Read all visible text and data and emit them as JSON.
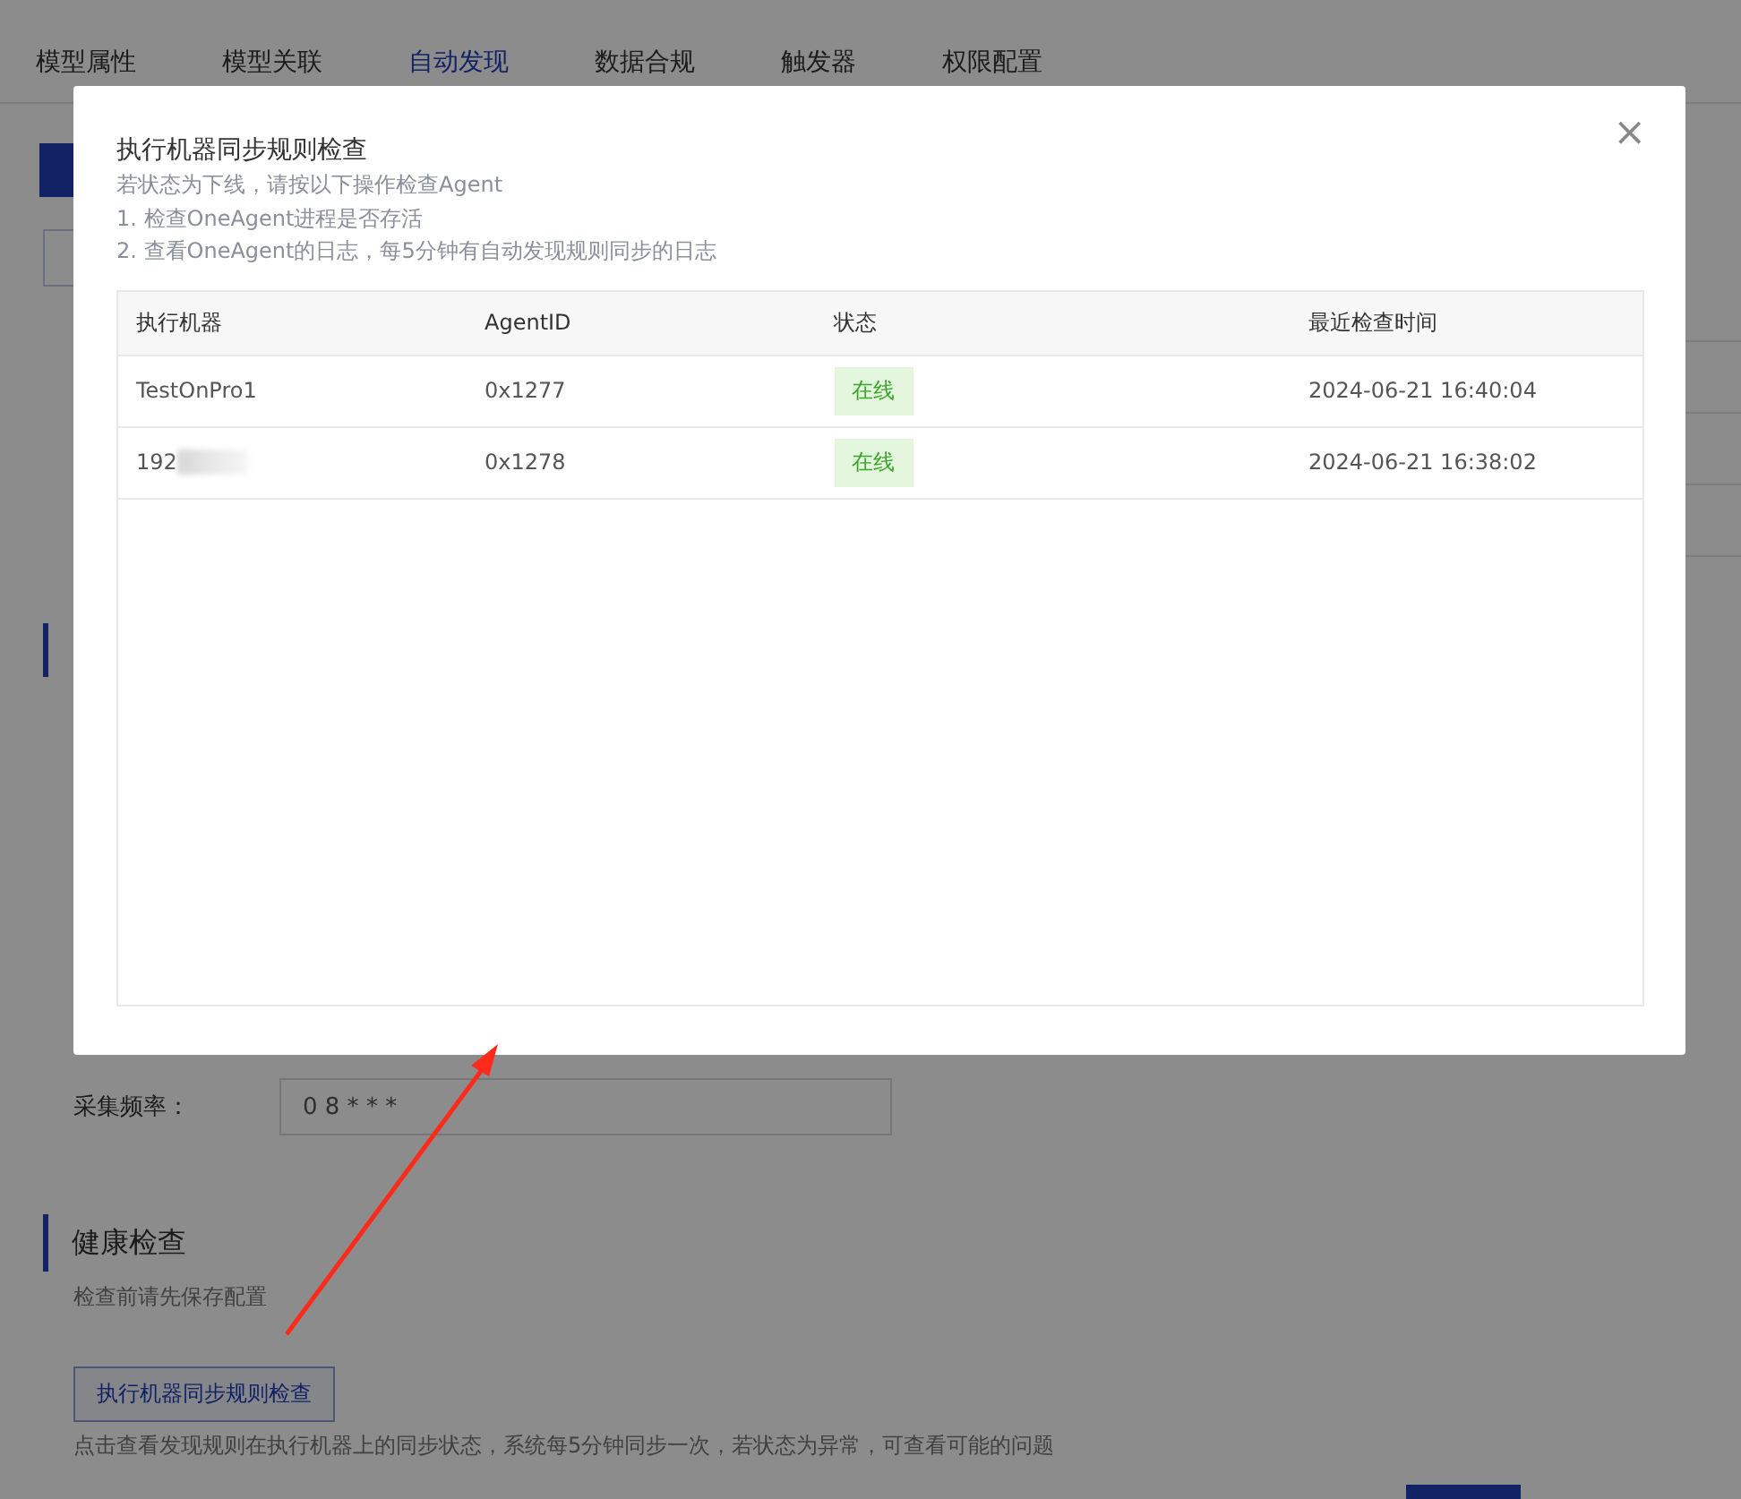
{
  "tabs": [
    {
      "label": "模型属性",
      "selected": false
    },
    {
      "label": "模型关联",
      "selected": false
    },
    {
      "label": "自动发现",
      "selected": true
    },
    {
      "label": "数据合规",
      "selected": false
    },
    {
      "label": "触发器",
      "selected": false
    },
    {
      "label": "权限配置",
      "selected": false
    }
  ],
  "form": {
    "frequency_label": "采集频率：",
    "frequency_value": "0 8 * * *"
  },
  "health": {
    "title": "健康检查",
    "subtitle": "检查前请先保存配置",
    "button": "执行机器同步规则检查",
    "hint": "点击查看发现规则在执行机器上的同步状态，系统每5分钟同步一次，若状态为异常，可查看可能的问题"
  },
  "modal": {
    "title": "执行机器同步规则检查",
    "close": "×",
    "hints": [
      "若状态为下线，请按以下操作检查Agent",
      "1. 检查OneAgent进程是否存活",
      "2. 查看OneAgent的日志，每5分钟有自动发现规则同步的日志"
    ],
    "table": {
      "columns": [
        "执行机器",
        "AgentID",
        "状态",
        "最近检查时间"
      ],
      "rows": [
        {
          "machine": "TestOnPro1",
          "redacted": false,
          "agent_id": "0x1277",
          "status": {
            "text": "在线",
            "kind": "online"
          },
          "checked_at": "2024-06-21 16:40:04"
        },
        {
          "machine": "192",
          "redacted": true,
          "agent_id": "0x1278",
          "status": {
            "text": "在线",
            "kind": "online"
          },
          "checked_at": "2024-06-21 16:38:02"
        }
      ]
    }
  }
}
